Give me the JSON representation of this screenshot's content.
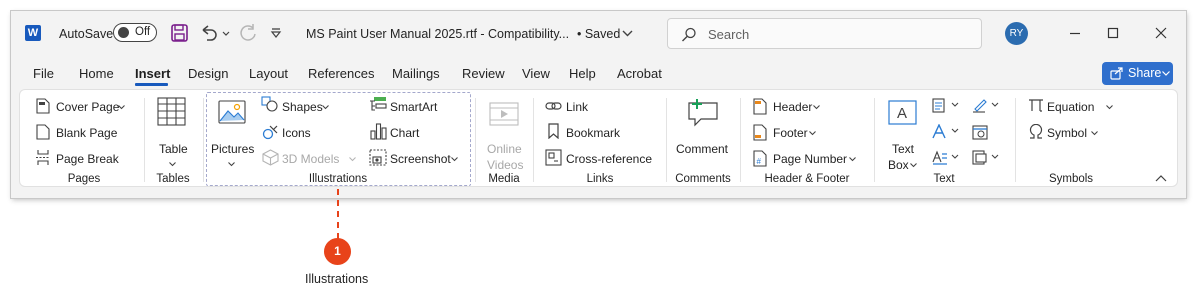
{
  "titlebar": {
    "app_icon": "W",
    "autosave_label": "AutoSave",
    "autosave_state": "Off",
    "doc_title": "MS Paint User Manual 2025.rtf  -  Compatibility...",
    "saved_status": "• Saved",
    "search_placeholder": "Search",
    "avatar_initials": "RY"
  },
  "tabs": [
    "File",
    "Home",
    "Insert",
    "Design",
    "Layout",
    "References",
    "Mailings",
    "Review",
    "View",
    "Help",
    "Acrobat"
  ],
  "active_tab": "Insert",
  "share_label": "Share",
  "ribbon": {
    "pages": {
      "cover_page": "Cover Page",
      "blank_page": "Blank Page",
      "page_break": "Page Break",
      "label": "Pages"
    },
    "tables": {
      "table": "Table",
      "label": "Tables"
    },
    "illustrations": {
      "pictures": "Pictures",
      "shapes": "Shapes",
      "icons": "Icons",
      "models_3d": "3D Models",
      "smartart": "SmartArt",
      "chart": "Chart",
      "screenshot": "Screenshot",
      "label": "Illustrations"
    },
    "media": {
      "online_videos_1": "Online",
      "online_videos_2": "Videos",
      "label": "Media"
    },
    "links": {
      "link": "Link",
      "bookmark": "Bookmark",
      "cross_reference": "Cross-reference",
      "label": "Links"
    },
    "comments": {
      "comment": "Comment",
      "label": "Comments"
    },
    "header_footer": {
      "header": "Header",
      "footer": "Footer",
      "page_number": "Page Number",
      "label": "Header & Footer"
    },
    "text": {
      "text_box_1": "Text",
      "text_box_2": "Box",
      "label": "Text"
    },
    "symbols": {
      "equation": "Equation",
      "symbol": "Symbol",
      "label": "Symbols"
    }
  },
  "callout": {
    "number": "1",
    "label": "Illustrations"
  },
  "colors": {
    "accent": "#185abd",
    "callout": "#e8431a",
    "share": "#2f6fcd"
  }
}
